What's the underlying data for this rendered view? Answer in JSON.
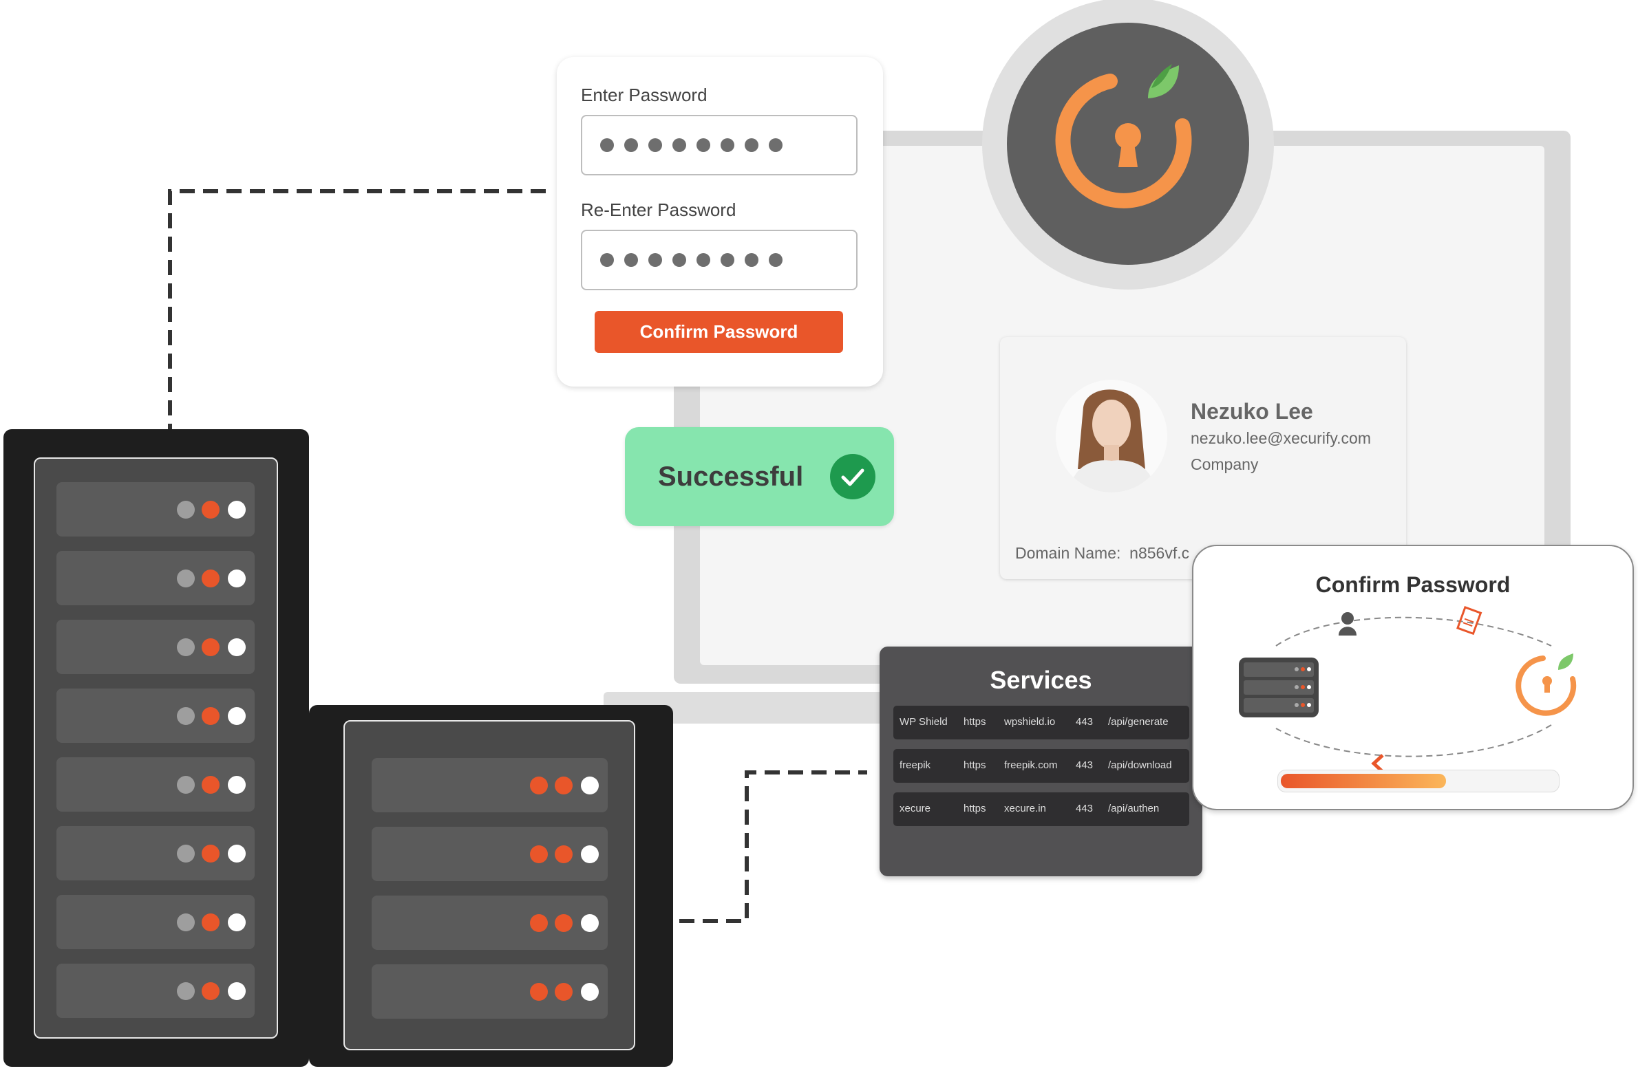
{
  "password_form": {
    "enter_label": "Enter Password",
    "reenter_label": "Re-Enter Password",
    "masked_length": 8,
    "confirm_button": "Confirm Password"
  },
  "status": {
    "label": "Successful",
    "icon": "check-icon",
    "color": "#86e5ae"
  },
  "profile": {
    "name": "Nezuko Lee",
    "email": "nezuko.lee@xecurify.com",
    "company": "Company",
    "domain_label": "Domain Name:",
    "domain_value": "n856vf.c"
  },
  "services": {
    "title": "Services",
    "rows": [
      {
        "name": "WP Shield",
        "protocol": "https",
        "host": "wpshield.io",
        "port": "443",
        "path": "/api/generate"
      },
      {
        "name": "freepik",
        "protocol": "https",
        "host": "freepik.com",
        "port": "443",
        "path": "/api/download"
      },
      {
        "name": "xecure",
        "protocol": "https",
        "host": "xecure.in",
        "port": "443",
        "path": "/api/authen"
      }
    ]
  },
  "confirm_card": {
    "title": "Confirm Password",
    "progress_percent": 60
  },
  "colors": {
    "accent": "#e9562a",
    "logo_orange": "#f5944a",
    "leaf_green": "#6cbf5a",
    "success_check": "#1e9a4e"
  }
}
